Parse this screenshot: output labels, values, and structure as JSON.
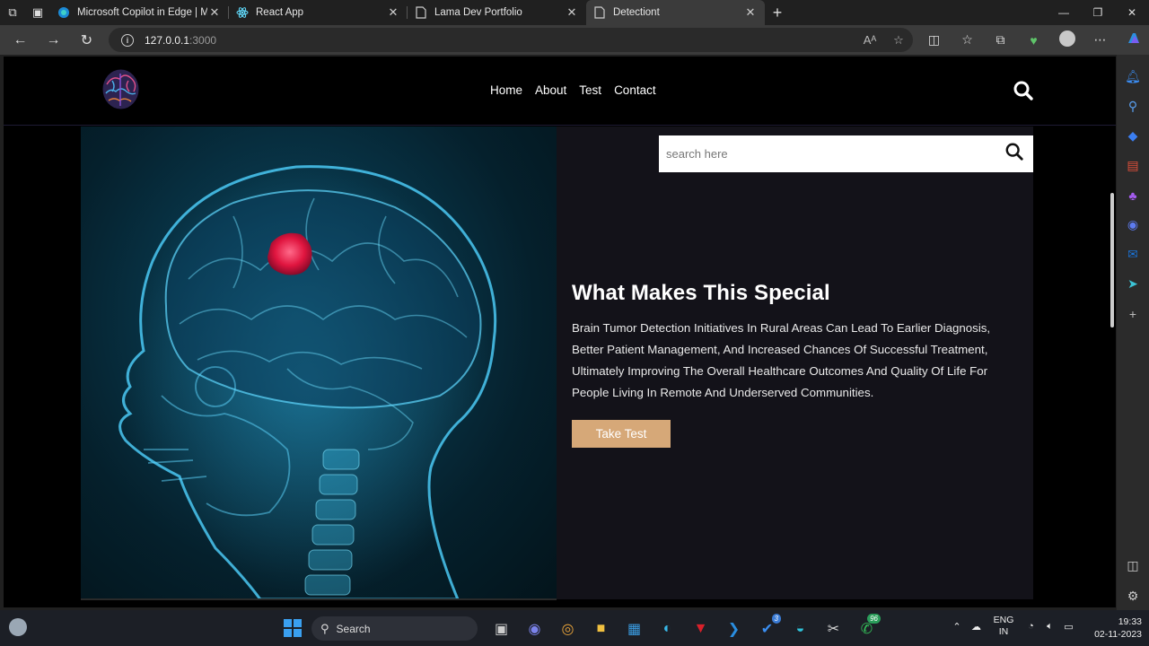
{
  "browser": {
    "tabs": [
      {
        "label": "Microsoft Copilot in Edge | Micro",
        "icon": "copilot-icon",
        "active": false
      },
      {
        "label": "React App",
        "icon": "react-icon",
        "active": false
      },
      {
        "label": "Lama Dev Portfolio",
        "icon": "page-icon",
        "active": false
      },
      {
        "label": "Detectiont",
        "icon": "page-icon",
        "active": true
      }
    ],
    "url_host": "127.0.0.1",
    "url_port": ":3000",
    "read_aloud": "Aᴬ"
  },
  "site": {
    "nav": [
      "Home",
      "About",
      "Test",
      "Contact"
    ],
    "search_placeholder": "search here",
    "heading": "What Makes This Special",
    "body": "Brain Tumor Detection Initiatives In Rural Areas Can Lead To Earlier Diagnosis, Better Patient Management, And Increased Chances Of Successful Treatment, Ultimately Improving The Overall Healthcare Outcomes And Quality Of Life For People Living In Remote And Underserved Communities.",
    "cta": "Take Test",
    "colors": {
      "cta": "#d6a878",
      "section_bg": "#131219",
      "header_bg": "#000000"
    }
  },
  "taskbar": {
    "search_label": "Search",
    "lang_line1": "ENG",
    "lang_line2": "IN",
    "time": "19:33",
    "date": "02-11-2023",
    "badge_tasks": "3",
    "badge_whatsapp": "96"
  }
}
